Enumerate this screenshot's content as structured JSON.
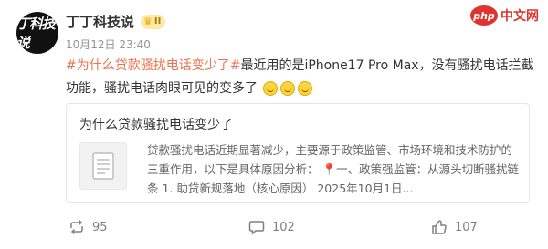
{
  "watermark": {
    "logo_text": "php",
    "site_text": "中文网"
  },
  "author": {
    "avatar_text": "丁科技说",
    "name": "丁丁科技说",
    "badge": "II"
  },
  "post": {
    "timestamp": "10月12日 23:40",
    "hashtag": "#为什么贷款骚扰电话变少了#",
    "body": "最近用的是iPhone17 Pro Max，没有骚扰电话拦截功能，骚扰电话肉眼可见的变多了",
    "emojis": [
      "laugh-cry",
      "laugh-cry",
      "laugh-cry"
    ]
  },
  "card": {
    "title": "为什么贷款骚扰电话变少了",
    "summary_part1": "贷款骚扰电话近期显著减少，主要源于政策监管、市场环境和技术防护的三重作用，以下是具体原因分析：",
    "summary_part2": "一、政策强监管：从源头切断骚扰链条 1. 助贷新规落地（核心原因） 2025年10月1日...",
    "pin_icon": "pin-icon"
  },
  "actions": {
    "repost_count": "95",
    "comment_count": "102",
    "like_count": "107"
  },
  "colors": {
    "hashtag": "#eb7350",
    "meta": "#939393",
    "watermark": "#e0332e"
  }
}
